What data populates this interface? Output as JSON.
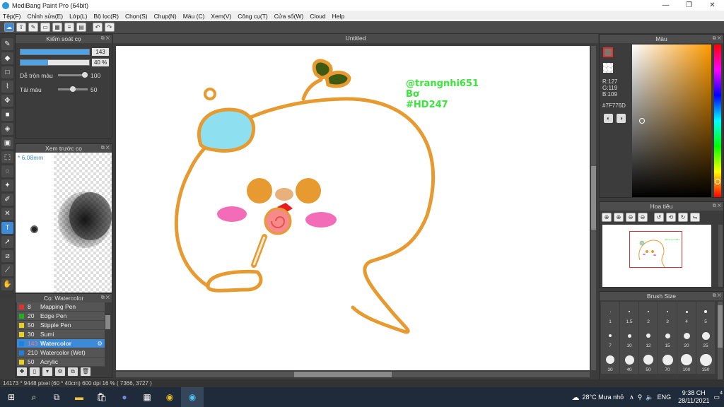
{
  "window": {
    "title": "MediBang Paint Pro (64bit)",
    "controls": [
      "—",
      "❐",
      "✕"
    ]
  },
  "menu": [
    "Tệp(F)",
    "Chỉnh sửa(E)",
    "Lớp(L)",
    "Bộ lọc(R)",
    "Chọn(S)",
    "Chụp(N)",
    "Màu (C)",
    "Xem(V)",
    "Công cụ(T)",
    "Cửa sổ(W)",
    "Cloud",
    "Help"
  ],
  "brush_control": {
    "title": "Kiểm soát cọ",
    "size_value": "143",
    "size_fraction": 1.0,
    "opacity_value": "40 %",
    "opacity_fraction": 0.4,
    "blend_label": "Dễ trộn màu",
    "blend_value": "100",
    "blend_fraction": 1.0,
    "reload_label": "Tải màu",
    "reload_value": "50",
    "reload_fraction": 0.5
  },
  "brush_preview": {
    "title": "Xem trước cọ",
    "size_text": "* 6.08mm"
  },
  "brush_list": {
    "title": "Cọ: Watercolor",
    "items": [
      {
        "num": "8",
        "name": "Mapping Pen",
        "color": "#e03030"
      },
      {
        "num": "20",
        "name": "Edge Pen",
        "color": "#20b020"
      },
      {
        "num": "50",
        "name": "Stipple Pen",
        "color": "#e8d020"
      },
      {
        "num": "30",
        "name": "Sumi",
        "color": "#e8d020"
      },
      {
        "num": "143",
        "name": "Watercolor",
        "color": "#2080e0"
      },
      {
        "num": "210",
        "name": "Watercolor (Wet)",
        "color": "#2080e0"
      },
      {
        "num": "50",
        "name": "Acrylic",
        "color": "#e8d020"
      }
    ]
  },
  "document": {
    "tab": "Untitled"
  },
  "canvas_text": {
    "line1": "@trangnhi651",
    "line2": "Bơ",
    "line3": "#HD247",
    "color": "#39e639"
  },
  "color_panel": {
    "title": "Màu",
    "r": "R:127",
    "g": "G:119",
    "b": "B:109",
    "hex": "#7F776D",
    "fg": "#7f776d"
  },
  "navigator": {
    "title": "Hoa tiêu"
  },
  "brush_size": {
    "title": "Brush Size",
    "rows": [
      [
        "1",
        "1.5",
        "2",
        "3",
        "4",
        "5"
      ],
      [
        "7",
        "10",
        "12",
        "15",
        "20",
        "25"
      ],
      [
        "30",
        "40",
        "50",
        "70",
        "100",
        "150"
      ]
    ]
  },
  "status": {
    "text": "14173 * 9448 pixel   (60 * 40cm)   600 dpi   16 %   ( 7366, 3727 )"
  },
  "taskbar": {
    "weather": "28°C  Mưa nhỏ",
    "lang": "ENG",
    "time": "9:38 CH",
    "date": "28/11/2021",
    "notifications": "4"
  }
}
